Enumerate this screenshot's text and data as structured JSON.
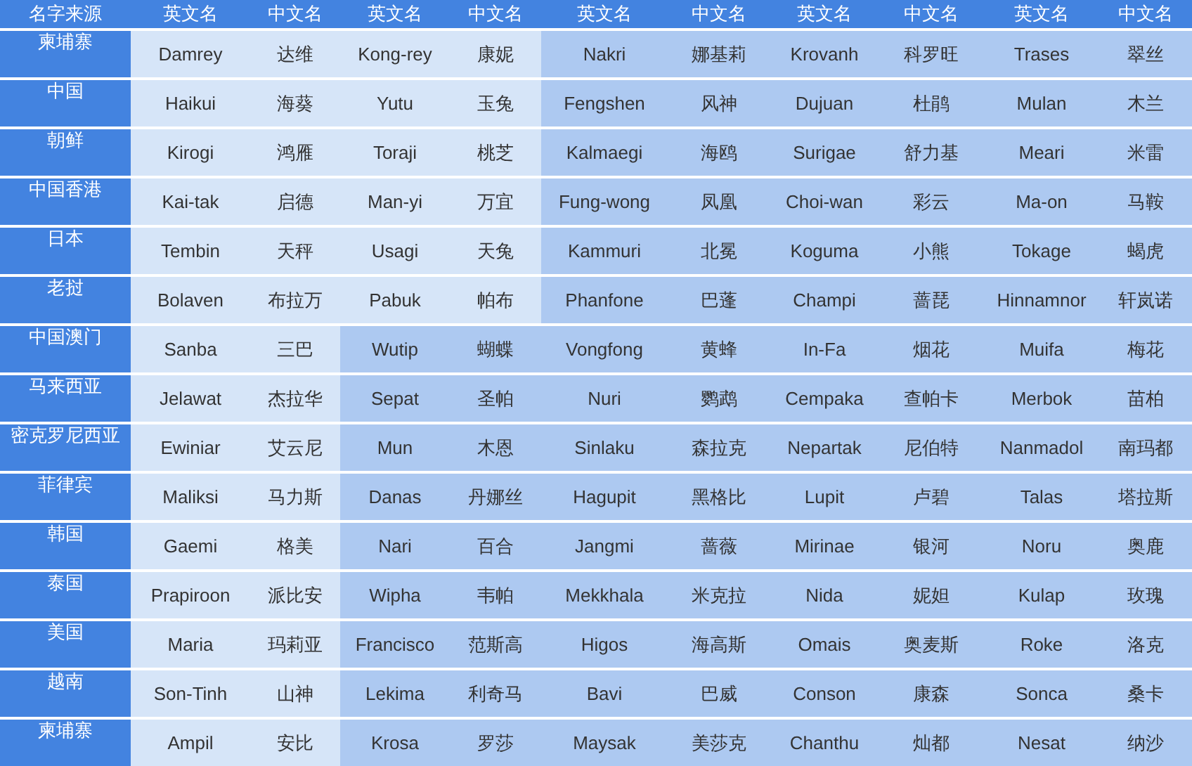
{
  "table": {
    "columns": [
      "名字来源",
      "英文名",
      "中文名",
      "英文名",
      "中文名",
      "英文名",
      "中文名",
      "英文名",
      "中文名",
      "英文名",
      "中文名"
    ],
    "rows": [
      {
        "origin": "柬埔寨",
        "names": [
          {
            "en": "Damrey",
            "zh": "达维",
            "shaded": false
          },
          {
            "en": "Kong-rey",
            "zh": "康妮",
            "shaded": false
          },
          {
            "en": "Nakri",
            "zh": "娜基莉",
            "shaded": true
          },
          {
            "en": "Krovanh",
            "zh": "科罗旺",
            "shaded": true
          },
          {
            "en": "Trases",
            "zh": "翠丝",
            "shaded": true
          }
        ]
      },
      {
        "origin": "中国",
        "names": [
          {
            "en": "Haikui",
            "zh": "海葵",
            "shaded": false
          },
          {
            "en": "Yutu",
            "zh": "玉兔",
            "shaded": false
          },
          {
            "en": "Fengshen",
            "zh": "风神",
            "shaded": true
          },
          {
            "en": "Dujuan",
            "zh": "杜鹃",
            "shaded": true
          },
          {
            "en": "Mulan",
            "zh": "木兰",
            "shaded": true
          }
        ]
      },
      {
        "origin": "朝鲜",
        "names": [
          {
            "en": "Kirogi",
            "zh": "鸿雁",
            "shaded": false
          },
          {
            "en": "Toraji",
            "zh": "桃芝",
            "shaded": false
          },
          {
            "en": "Kalmaegi",
            "zh": "海鸥",
            "shaded": true
          },
          {
            "en": "Surigae",
            "zh": "舒力基",
            "shaded": true
          },
          {
            "en": "Meari",
            "zh": "米雷",
            "shaded": true
          }
        ]
      },
      {
        "origin": "中国香港",
        "names": [
          {
            "en": "Kai-tak",
            "zh": "启德",
            "shaded": false
          },
          {
            "en": "Man-yi",
            "zh": "万宜",
            "shaded": false
          },
          {
            "en": "Fung-wong",
            "zh": "凤凰",
            "shaded": true
          },
          {
            "en": "Choi-wan",
            "zh": "彩云",
            "shaded": true
          },
          {
            "en": "Ma-on",
            "zh": "马鞍",
            "shaded": true
          }
        ]
      },
      {
        "origin": "日本",
        "names": [
          {
            "en": "Tembin",
            "zh": "天秤",
            "shaded": false
          },
          {
            "en": "Usagi",
            "zh": "天兔",
            "shaded": false
          },
          {
            "en": "Kammuri",
            "zh": "北冕",
            "shaded": true
          },
          {
            "en": "Koguma",
            "zh": "小熊",
            "shaded": true
          },
          {
            "en": "Tokage",
            "zh": "蝎虎",
            "shaded": true
          }
        ]
      },
      {
        "origin": "老挝",
        "names": [
          {
            "en": "Bolaven",
            "zh": "布拉万",
            "shaded": false
          },
          {
            "en": "Pabuk",
            "zh": "帕布",
            "shaded": false
          },
          {
            "en": "Phanfone",
            "zh": "巴蓬",
            "shaded": true
          },
          {
            "en": "Champi",
            "zh": "蔷琵",
            "shaded": true
          },
          {
            "en": "Hinnamnor",
            "zh": "轩岚诺",
            "shaded": true
          }
        ]
      },
      {
        "origin": "中国澳门",
        "names": [
          {
            "en": "Sanba",
            "zh": "三巴",
            "shaded": false
          },
          {
            "en": "Wutip",
            "zh": "蝴蝶",
            "shaded": true
          },
          {
            "en": "Vongfong",
            "zh": "黄蜂",
            "shaded": true
          },
          {
            "en": "In-Fa",
            "zh": "烟花",
            "shaded": true
          },
          {
            "en": "Muifa",
            "zh": "梅花",
            "shaded": true
          }
        ]
      },
      {
        "origin": "马来西亚",
        "names": [
          {
            "en": "Jelawat",
            "zh": "杰拉华",
            "shaded": false
          },
          {
            "en": "Sepat",
            "zh": "圣帕",
            "shaded": true
          },
          {
            "en": "Nuri",
            "zh": "鹦鹉",
            "shaded": true
          },
          {
            "en": "Cempaka",
            "zh": "查帕卡",
            "shaded": true
          },
          {
            "en": "Merbok",
            "zh": "苗柏",
            "shaded": true
          }
        ]
      },
      {
        "origin": "密克罗尼西亚",
        "names": [
          {
            "en": "Ewiniar",
            "zh": "艾云尼",
            "shaded": false
          },
          {
            "en": "Mun",
            "zh": "木恩",
            "shaded": true
          },
          {
            "en": "Sinlaku",
            "zh": "森拉克",
            "shaded": true
          },
          {
            "en": "Nepartak",
            "zh": "尼伯特",
            "shaded": true
          },
          {
            "en": "Nanmadol",
            "zh": "南玛都",
            "shaded": true
          }
        ]
      },
      {
        "origin": "菲律宾",
        "names": [
          {
            "en": "Maliksi",
            "zh": "马力斯",
            "shaded": false
          },
          {
            "en": "Danas",
            "zh": "丹娜丝",
            "shaded": true
          },
          {
            "en": "Hagupit",
            "zh": "黑格比",
            "shaded": true
          },
          {
            "en": "Lupit",
            "zh": "卢碧",
            "shaded": true
          },
          {
            "en": "Talas",
            "zh": "塔拉斯",
            "shaded": true
          }
        ]
      },
      {
        "origin": "韩国",
        "names": [
          {
            "en": "Gaemi",
            "zh": "格美",
            "shaded": false
          },
          {
            "en": "Nari",
            "zh": "百合",
            "shaded": true
          },
          {
            "en": "Jangmi",
            "zh": "蔷薇",
            "shaded": true
          },
          {
            "en": "Mirinae",
            "zh": "银河",
            "shaded": true
          },
          {
            "en": "Noru",
            "zh": "奥鹿",
            "shaded": true
          }
        ]
      },
      {
        "origin": "泰国",
        "names": [
          {
            "en": "Prapiroon",
            "zh": "派比安",
            "shaded": false
          },
          {
            "en": "Wipha",
            "zh": "韦帕",
            "shaded": true
          },
          {
            "en": "Mekkhala",
            "zh": "米克拉",
            "shaded": true
          },
          {
            "en": "Nida",
            "zh": "妮妲",
            "shaded": true
          },
          {
            "en": "Kulap",
            "zh": "玫瑰",
            "shaded": true
          }
        ]
      },
      {
        "origin": "美国",
        "names": [
          {
            "en": "Maria",
            "zh": "玛莉亚",
            "shaded": false
          },
          {
            "en": "Francisco",
            "zh": "范斯高",
            "shaded": true
          },
          {
            "en": "Higos",
            "zh": "海高斯",
            "shaded": true
          },
          {
            "en": "Omais",
            "zh": "奥麦斯",
            "shaded": true
          },
          {
            "en": "Roke",
            "zh": "洛克",
            "shaded": true
          }
        ]
      },
      {
        "origin": "越南",
        "names": [
          {
            "en": "Son-Tinh",
            "zh": "山神",
            "shaded": false
          },
          {
            "en": "Lekima",
            "zh": "利奇马",
            "shaded": true
          },
          {
            "en": "Bavi",
            "zh": "巴威",
            "shaded": true
          },
          {
            "en": "Conson",
            "zh": "康森",
            "shaded": true
          },
          {
            "en": "Sonca",
            "zh": "桑卡",
            "shaded": true
          }
        ]
      },
      {
        "origin": "柬埔寨",
        "names": [
          {
            "en": "Ampil",
            "zh": "安比",
            "shaded": false
          },
          {
            "en": "Krosa",
            "zh": "罗莎",
            "shaded": true
          },
          {
            "en": "Maysak",
            "zh": "美莎克",
            "shaded": true
          },
          {
            "en": "Chanthu",
            "zh": "灿都",
            "shaded": true
          },
          {
            "en": "Nesat",
            "zh": "纳沙",
            "shaded": true
          }
        ]
      }
    ]
  }
}
